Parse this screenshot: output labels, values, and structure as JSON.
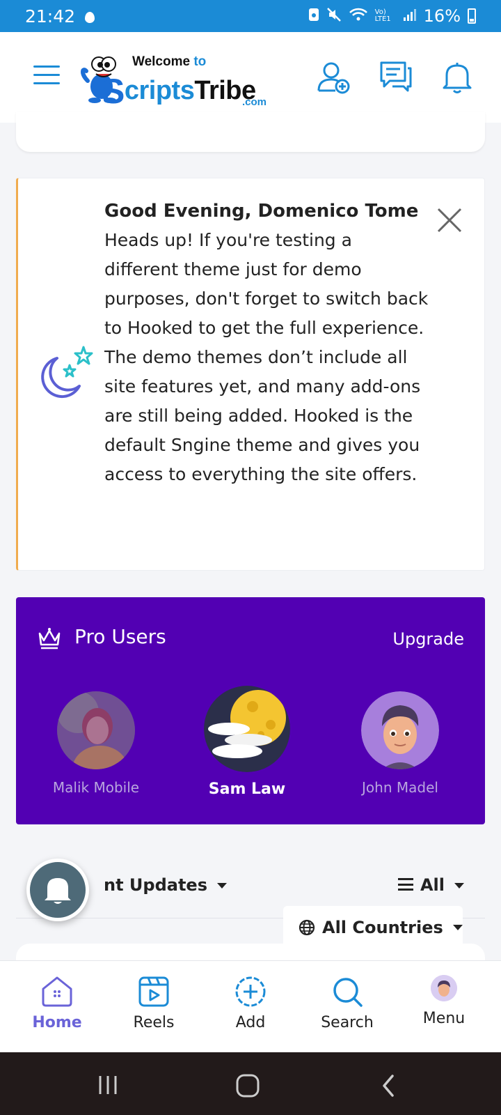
{
  "status_bar": {
    "time": "21:42",
    "battery": "16%",
    "network": "Vo) LTE1"
  },
  "header": {
    "logo": {
      "welcome": "Welcome",
      "to": "to",
      "brand_s": "S",
      "brand_scripts": "cripts",
      "brand_tribe": "Tribe",
      "domain": ".com"
    },
    "icons": [
      "menu-icon",
      "add-friend-icon",
      "messages-icon",
      "notifications-icon"
    ]
  },
  "alert": {
    "greeting": "Good Evening, Domenico Tome",
    "message": "Heads up! If you're testing a different theme just for demo purposes, don't forget to switch back to Hooked to get the full experience. The demo themes don’t include all site features yet, and many add-ons are still being added. Hooked is the default Sngine theme and gives you access to everything the site offers."
  },
  "pro_users": {
    "title": "Pro Users",
    "upgrade_label": "Upgrade",
    "users": [
      {
        "name": "Malik Mobile"
      },
      {
        "name": "Sam Law"
      },
      {
        "name": "John Madel"
      }
    ]
  },
  "feed_filters": {
    "updates_label": "nt Updates",
    "all_label": "All",
    "countries_label": "All Countries"
  },
  "bottom_nav": {
    "items": [
      {
        "label": "Home",
        "active": true
      },
      {
        "label": "Reels"
      },
      {
        "label": "Add"
      },
      {
        "label": "Search"
      },
      {
        "label": "Menu"
      }
    ]
  },
  "colors": {
    "status_bar": "#1b8bd6",
    "brand_blue": "#1b8bd6",
    "pro_bg": "#5200b3",
    "alert_accent": "#f0ac4f",
    "nav_active": "#6a63d8",
    "fab": "#4e6a78"
  }
}
